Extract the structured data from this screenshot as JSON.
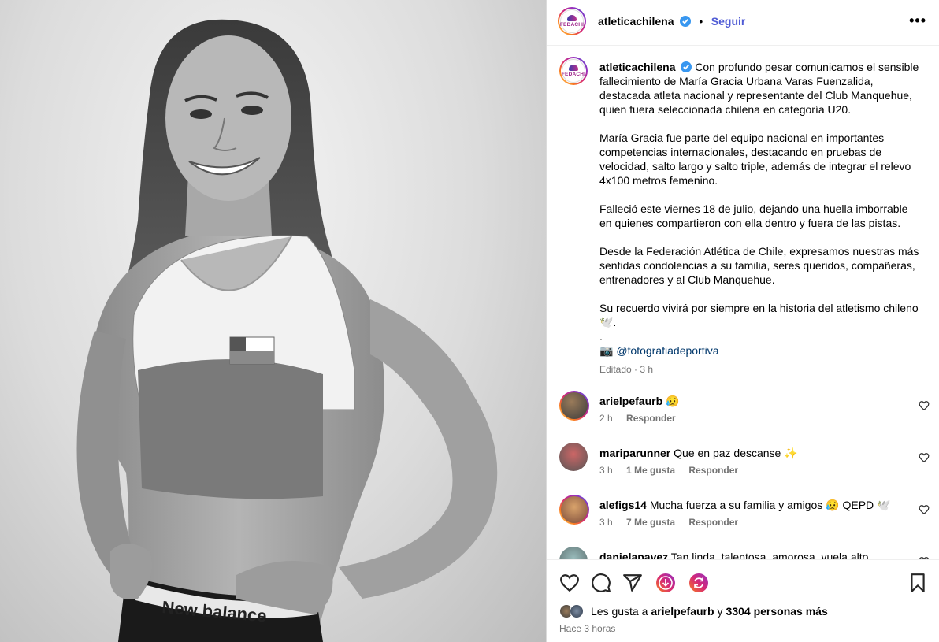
{
  "account": {
    "username": "atleticachilena",
    "follow_label": "Seguir",
    "logo_text": "FEDACHI"
  },
  "caption": {
    "paragraphs": [
      "Con profundo pesar comunicamos el sensible fallecimiento de María Gracia Urbana Varas Fuenzalida, destacada atleta nacional y representante del Club Manquehue, quien fuera seleccionada chilena en categoría U20.",
      "María Gracia fue parte del equipo nacional en importantes competencias internacionales, destacando en pruebas de velocidad, salto largo y salto triple, además de integrar el relevo 4x100 metros femenino.",
      "Falleció este viernes 18 de julio, dejando una huella imborrable en quienes compartieron con ella dentro y fuera de las pistas.",
      "Desde la Federación Atlética de Chile, expresamos nuestras más sentidas condolencias a su familia, seres queridos, compañeras, entrenadores y al Club Manquehue.",
      "Su recuerdo vivirá por siempre en la historia del atletismo chileno 🕊️."
    ],
    "dot_line": ".",
    "camera_emoji": "📷",
    "credit": "@fotografiadeportiva",
    "edited_meta": "Editado · 3 h"
  },
  "comments": [
    {
      "user": "arielpefaurb",
      "text": "😥",
      "time": "2 h",
      "likes": "",
      "reply": "Responder"
    },
    {
      "user": "mariparunner",
      "text": "Que en paz descanse ✨",
      "time": "3 h",
      "likes": "1 Me gusta",
      "reply": "Responder"
    },
    {
      "user": "alefigs14",
      "text": "Mucha fuerza a su familia y amigos 😥 QEPD 🕊️",
      "time": "3 h",
      "likes": "7 Me gusta",
      "reply": "Responder"
    },
    {
      "user": "danielapavez",
      "text": "Tan linda, talentosa, amorosa, vuela alto María",
      "time": "",
      "likes": "",
      "reply": ""
    }
  ],
  "likes": {
    "prefix": "Les gusta a ",
    "user": "arielpefaurb",
    "middle": " y ",
    "count": "3304 personas más"
  },
  "posted": "Hace 3 horas",
  "photo": {
    "brand_text": "New balance"
  },
  "colors": {
    "follow": "#4f5bd5",
    "verified": "#3897f0",
    "mention": "#00376b",
    "meta": "#737373"
  },
  "icons": [
    "heart-icon",
    "comment-icon",
    "share-icon",
    "download-icon",
    "sync-icon",
    "bookmark-icon",
    "more-icon",
    "verified-icon"
  ]
}
